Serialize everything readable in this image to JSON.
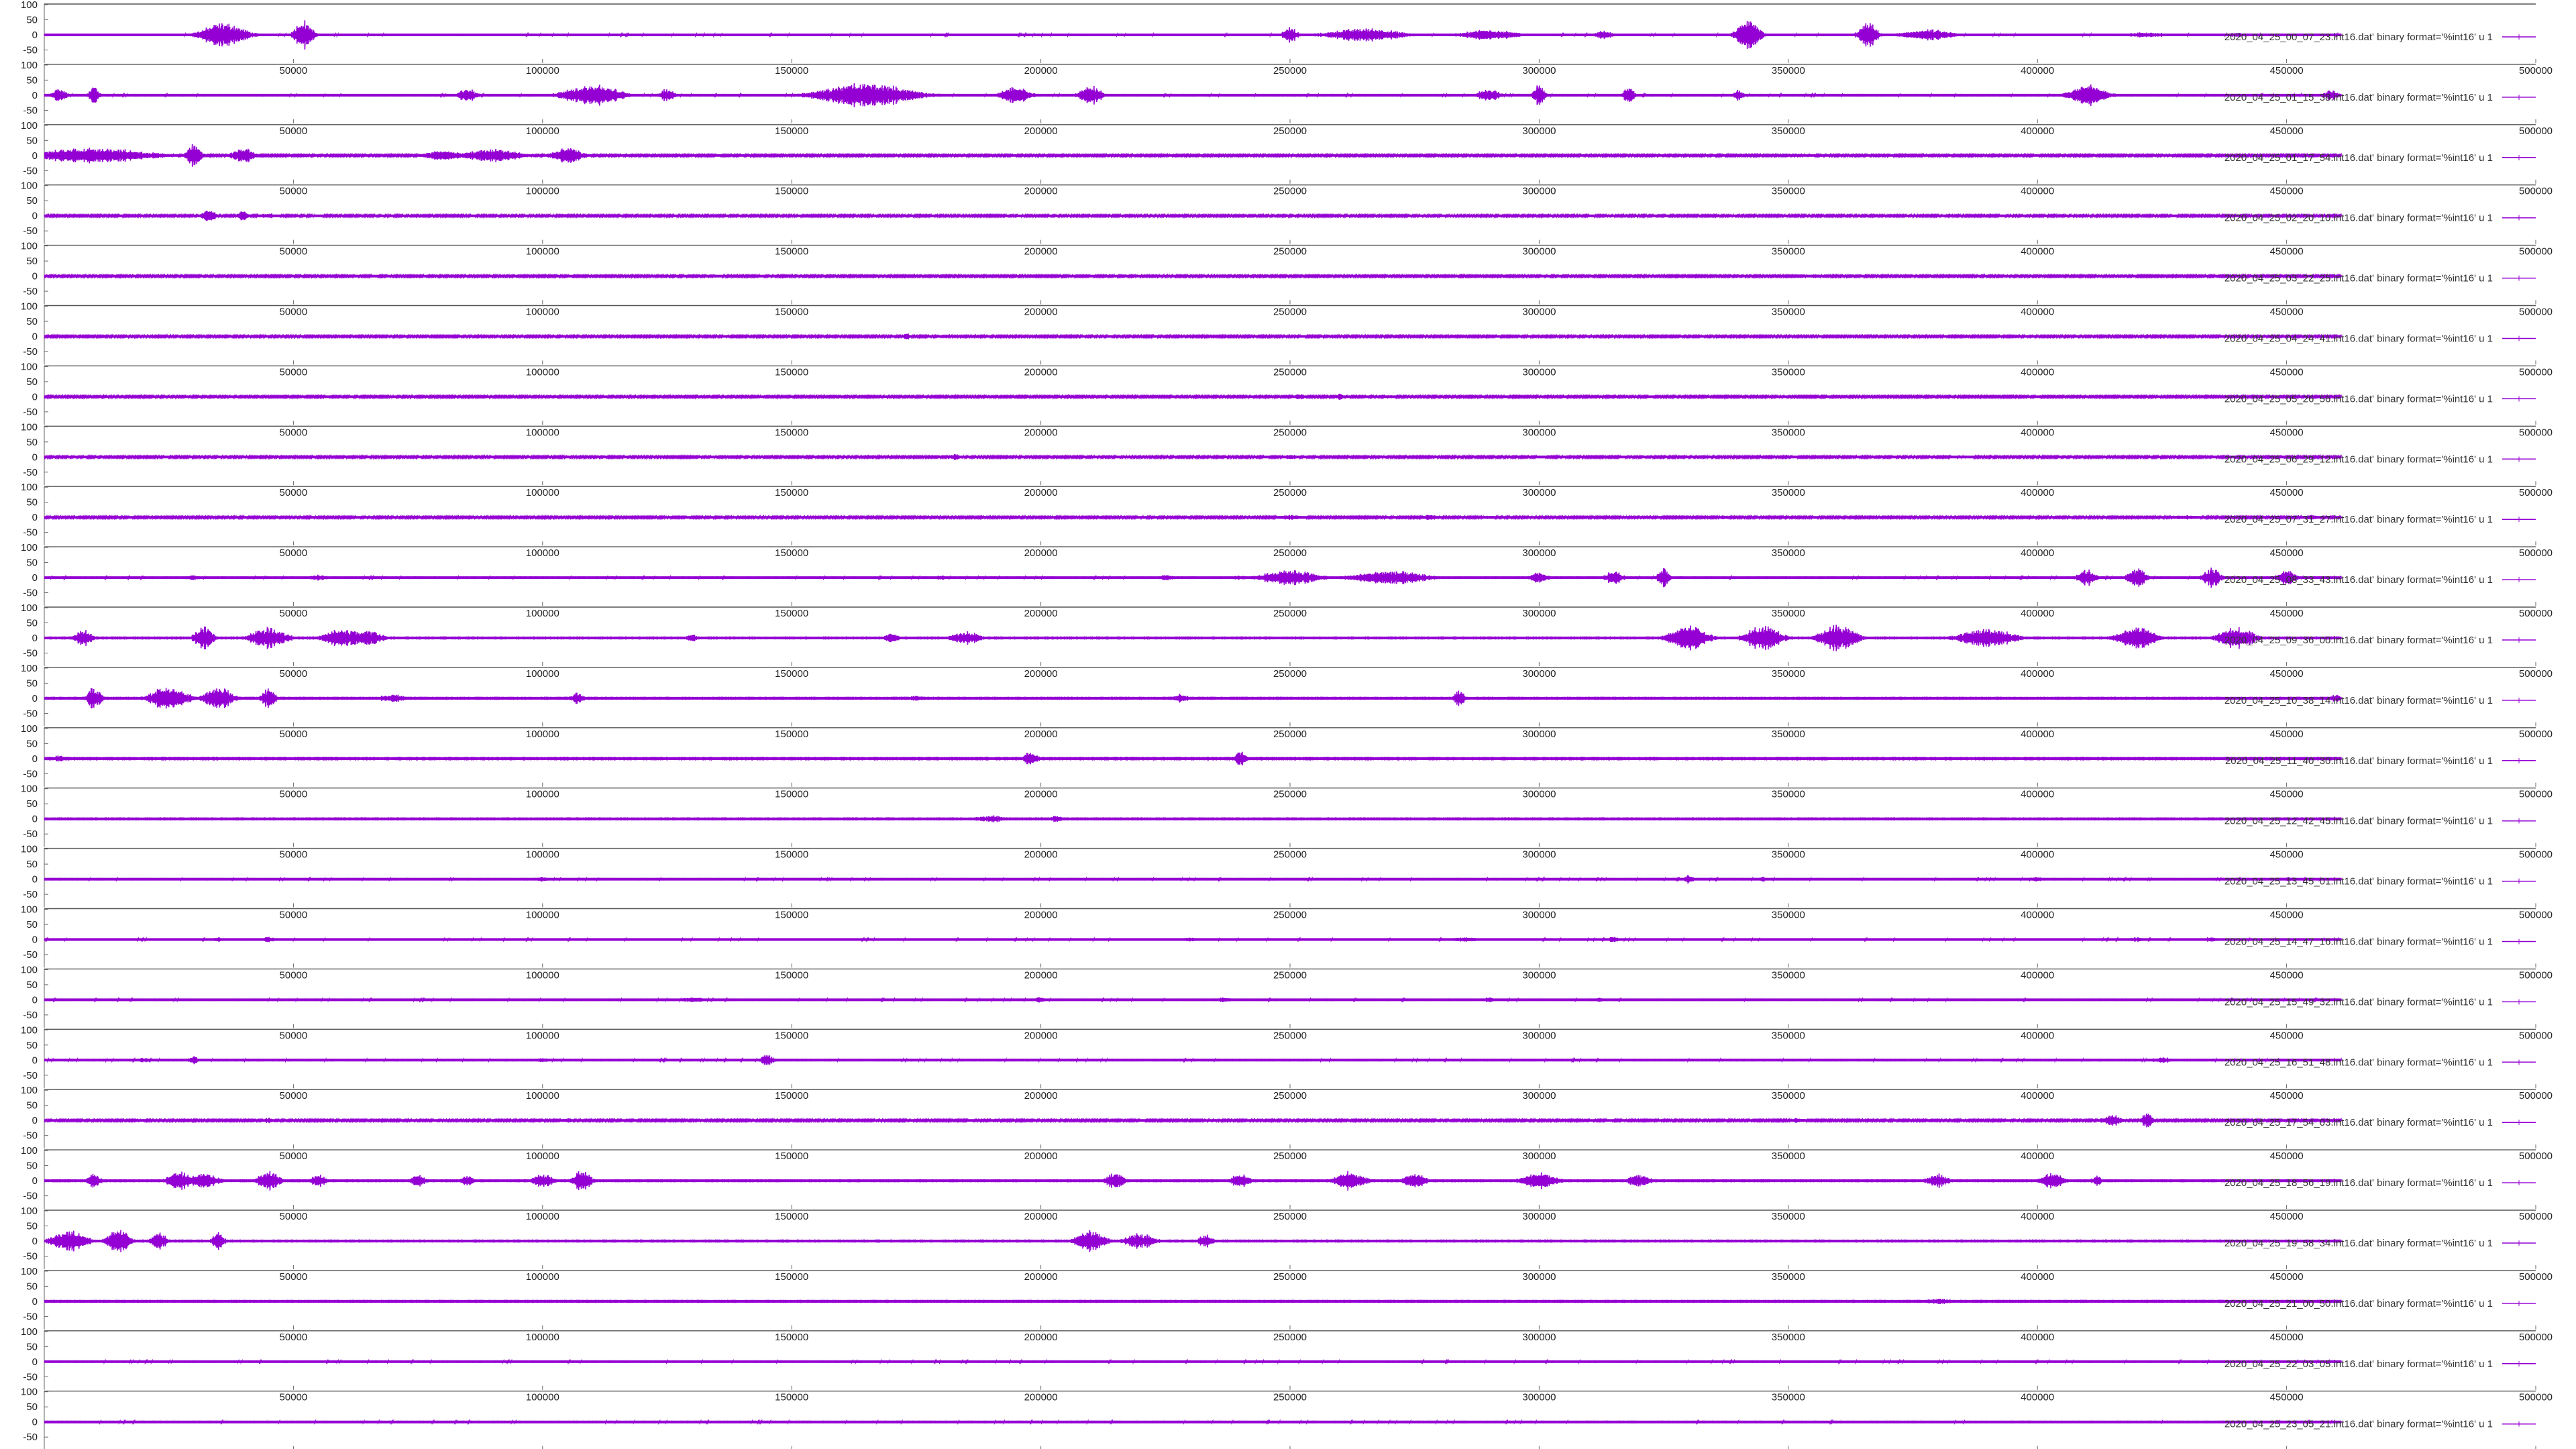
{
  "chart_data": {
    "type": "line",
    "layout": "stacked-subplots",
    "title": "",
    "xlabel": "",
    "ylabel": "",
    "xlim": [
      0,
      500000
    ],
    "ylim": [
      -100,
      100
    ],
    "xticks": [
      50000,
      100000,
      150000,
      200000,
      250000,
      300000,
      350000,
      400000,
      450000,
      500000
    ],
    "yticks": [
      100,
      50,
      0,
      -50
    ],
    "data_end_x": 461000,
    "grid": false,
    "legend_position": "right",
    "series_color": "#9400d3",
    "series_style": "lines+points",
    "series": [
      {
        "name": "2020_04_25_00_07_23.int16.dat' binary format='%int16' u 1",
        "noise": 4,
        "bursts": [
          [
            36000,
            12000,
            45
          ],
          [
            52000,
            5000,
            55
          ],
          [
            250000,
            4000,
            30
          ],
          [
            265000,
            20000,
            25
          ],
          [
            290000,
            15000,
            20
          ],
          [
            313000,
            5000,
            15
          ],
          [
            342000,
            6000,
            60
          ],
          [
            366000,
            5000,
            45
          ],
          [
            378000,
            14000,
            20
          ],
          [
            422000,
            12000,
            10
          ],
          [
            440000,
            8000,
            8
          ]
        ]
      },
      {
        "name": "2020_04_25_01_15_38.int16.dat' binary format='%int16' u 1",
        "noise": 4,
        "bursts": [
          [
            3000,
            4000,
            25
          ],
          [
            10000,
            3000,
            30
          ],
          [
            85000,
            5000,
            25
          ],
          [
            110000,
            15000,
            40
          ],
          [
            125000,
            4000,
            25
          ],
          [
            165000,
            25000,
            45
          ],
          [
            195000,
            8000,
            30
          ],
          [
            210000,
            6000,
            35
          ],
          [
            290000,
            6000,
            25
          ],
          [
            300000,
            3000,
            40
          ],
          [
            318000,
            3000,
            30
          ],
          [
            340000,
            3000,
            20
          ],
          [
            410000,
            10000,
            40
          ],
          [
            459000,
            4000,
            20
          ]
        ]
      },
      {
        "name": "2020_04_25_01_17_54.int16.dat' binary format='%int16' u 1",
        "noise": 3,
        "bursts": [
          [
            10000,
            30000,
            30
          ],
          [
            30000,
            4000,
            45
          ],
          [
            40000,
            6000,
            30
          ],
          [
            80000,
            10000,
            20
          ],
          [
            90000,
            15000,
            25
          ],
          [
            105000,
            8000,
            30
          ],
          [
            355000,
            15000,
            5
          ]
        ]
      },
      {
        "name": "2020_04_25_02_20_10.int16.dat' binary format='%int16' u 1",
        "noise": 3,
        "bursts": [
          [
            33000,
            4000,
            25
          ],
          [
            40000,
            3000,
            20
          ],
          [
            45000,
            6000,
            10
          ],
          [
            55000,
            4000,
            5
          ]
        ]
      },
      {
        "name": "2020_04_25_03_22_25.int16.dat' binary format='%int16' u 1",
        "noise": 3,
        "bursts": [
          [
            135000,
            6000,
            5
          ],
          [
            355000,
            5000,
            8
          ]
        ]
      },
      {
        "name": "2020_04_25_04_24_41.int16.dat' binary format='%int16' u 1",
        "noise": 3,
        "bursts": [
          [
            173000,
            2000,
            15
          ],
          [
            70000,
            10000,
            4
          ]
        ]
      },
      {
        "name": "2020_04_25_05_26_56.int16.dat' binary format='%int16' u 1",
        "noise": 3,
        "bursts": [
          [
            70000,
            3000,
            5
          ],
          [
            252000,
            4000,
            10
          ],
          [
            260000,
            2000,
            15
          ],
          [
            270000,
            5000,
            6
          ],
          [
            400000,
            4000,
            6
          ]
        ]
      },
      {
        "name": "2020_04_25_06_29_12.int16.dat' binary format='%int16' u 1",
        "noise": 3,
        "bursts": [
          [
            183000,
            3000,
            12
          ],
          [
            250000,
            4000,
            10
          ],
          [
            300000,
            5000,
            5
          ],
          [
            385000,
            10000,
            5
          ]
        ]
      },
      {
        "name": "2020_04_25_07_31_27.int16.dat' binary format='%int16' u 1",
        "noise": 3,
        "bursts": [
          [
            250000,
            8000,
            10
          ],
          [
            278000,
            5000,
            10
          ],
          [
            290000,
            4000,
            8
          ],
          [
            337000,
            3000,
            8
          ],
          [
            430000,
            10000,
            8
          ],
          [
            455000,
            5000,
            10
          ]
        ]
      },
      {
        "name": "2020_04_25_08_33_43.int16.dat' binary format='%int16' u 1",
        "noise": 4,
        "bursts": [
          [
            30000,
            4000,
            10
          ],
          [
            55000,
            6000,
            10
          ],
          [
            180000,
            4000,
            8
          ],
          [
            225000,
            5000,
            10
          ],
          [
            240000,
            5000,
            8
          ],
          [
            250000,
            15000,
            30
          ],
          [
            270000,
            20000,
            25
          ],
          [
            300000,
            5000,
            20
          ],
          [
            315000,
            5000,
            25
          ],
          [
            325000,
            3000,
            40
          ],
          [
            410000,
            5000,
            30
          ],
          [
            420000,
            5000,
            40
          ],
          [
            435000,
            5000,
            35
          ],
          [
            450000,
            5000,
            30
          ]
        ]
      },
      {
        "name": "2020_04_25_09_36_00.int16.dat' binary format='%int16' u 1",
        "noise": 5,
        "bursts": [
          [
            8000,
            5000,
            30
          ],
          [
            32000,
            5000,
            45
          ],
          [
            45000,
            10000,
            40
          ],
          [
            60000,
            10000,
            35
          ],
          [
            65000,
            8000,
            30
          ],
          [
            130000,
            3000,
            15
          ],
          [
            170000,
            4000,
            20
          ],
          [
            185000,
            8000,
            25
          ],
          [
            330000,
            10000,
            50
          ],
          [
            345000,
            10000,
            45
          ],
          [
            360000,
            10000,
            50
          ],
          [
            390000,
            15000,
            35
          ],
          [
            420000,
            10000,
            45
          ],
          [
            440000,
            10000,
            40
          ]
        ]
      },
      {
        "name": "2020_04_25_10_38_14.int16.dat' binary format='%int16' u 1",
        "noise": 5,
        "bursts": [
          [
            10000,
            4000,
            40
          ],
          [
            25000,
            10000,
            45
          ],
          [
            35000,
            8000,
            40
          ],
          [
            45000,
            4000,
            35
          ],
          [
            70000,
            8000,
            15
          ],
          [
            107000,
            4000,
            20
          ],
          [
            175000,
            5000,
            10
          ],
          [
            228000,
            5000,
            15
          ],
          [
            284000,
            3000,
            30
          ],
          [
            460000,
            3000,
            15
          ]
        ]
      },
      {
        "name": "2020_04_25_11_40_30.int16.dat' binary format='%int16' u 1",
        "noise": 6,
        "bursts": [
          [
            3000,
            3000,
            15
          ],
          [
            17000,
            3000,
            10
          ],
          [
            198000,
            4000,
            25
          ],
          [
            240000,
            3000,
            35
          ],
          [
            120000,
            10000,
            6
          ]
        ]
      },
      {
        "name": "2020_04_25_12_42_45.int16.dat' binary format='%int16' u 1",
        "noise": 5,
        "bursts": [
          [
            60000,
            10000,
            6
          ],
          [
            190000,
            10000,
            12
          ],
          [
            203000,
            3000,
            15
          ]
        ]
      },
      {
        "name": "2020_04_25_13_45_01.int16.dat' binary format='%int16' u 1",
        "noise": 4,
        "bursts": [
          [
            100000,
            3000,
            10
          ],
          [
            330000,
            3000,
            15
          ],
          [
            345000,
            3000,
            10
          ],
          [
            400000,
            4000,
            8
          ],
          [
            450000,
            8000,
            8
          ]
        ]
      },
      {
        "name": "2020_04_25_14_47_16.int16.dat' binary format='%int16' u 1",
        "noise": 4,
        "bursts": [
          [
            35000,
            3000,
            8
          ],
          [
            45000,
            4000,
            10
          ],
          [
            230000,
            6000,
            8
          ],
          [
            285000,
            8000,
            10
          ],
          [
            315000,
            3000,
            12
          ],
          [
            420000,
            6000,
            8
          ],
          [
            435000,
            4000,
            10
          ]
        ]
      },
      {
        "name": "2020_04_25_15_49_32.int16.dat' binary format='%int16' u 1",
        "noise": 4,
        "bursts": [
          [
            130000,
            8000,
            10
          ],
          [
            200000,
            3000,
            12
          ],
          [
            237000,
            4000,
            10
          ],
          [
            290000,
            3000,
            10
          ],
          [
            312000,
            3000,
            8
          ]
        ]
      },
      {
        "name": "2020_04_25_16_51_48.int16.dat' binary format='%int16' u 1",
        "noise": 4,
        "bursts": [
          [
            20000,
            3000,
            10
          ],
          [
            30000,
            3000,
            15
          ],
          [
            145000,
            4000,
            20
          ],
          [
            100000,
            5000,
            8
          ],
          [
            425000,
            5000,
            12
          ]
        ]
      },
      {
        "name": "2020_04_25_17_54_03.int16.dat' binary format='%int16' u 1",
        "noise": 3,
        "bursts": [
          [
            20000,
            4000,
            5
          ],
          [
            45000,
            3000,
            10
          ],
          [
            105000,
            4000,
            8
          ],
          [
            235000,
            5000,
            5
          ],
          [
            352000,
            4000,
            10
          ],
          [
            415000,
            6000,
            20
          ],
          [
            422000,
            3000,
            30
          ]
        ]
      },
      {
        "name": "2020_04_25_18_56_19.int16.dat' binary format='%int16' u 1",
        "noise": 5,
        "bursts": [
          [
            10000,
            4000,
            25
          ],
          [
            27000,
            6000,
            40
          ],
          [
            32000,
            8000,
            30
          ],
          [
            45000,
            6000,
            40
          ],
          [
            55000,
            4000,
            25
          ],
          [
            75000,
            4000,
            25
          ],
          [
            85000,
            4000,
            20
          ],
          [
            100000,
            6000,
            25
          ],
          [
            108000,
            5000,
            40
          ],
          [
            215000,
            5000,
            30
          ],
          [
            240000,
            5000,
            30
          ],
          [
            262000,
            8000,
            35
          ],
          [
            275000,
            6000,
            30
          ],
          [
            300000,
            10000,
            30
          ],
          [
            320000,
            6000,
            25
          ],
          [
            380000,
            6000,
            25
          ],
          [
            403000,
            6000,
            30
          ],
          [
            412000,
            3000,
            20
          ]
        ]
      },
      {
        "name": "2020_04_25_19_58_34.int16.dat' binary format='%int16' u 1",
        "noise": 5,
        "bursts": [
          [
            5000,
            10000,
            40
          ],
          [
            15000,
            6000,
            45
          ],
          [
            23000,
            4000,
            35
          ],
          [
            35000,
            3000,
            40
          ],
          [
            210000,
            8000,
            40
          ],
          [
            220000,
            8000,
            30
          ],
          [
            233000,
            4000,
            25
          ],
          [
            245000,
            6000,
            5
          ]
        ]
      },
      {
        "name": "2020_04_25_21_00_50.int16.dat' binary format='%int16' u 1",
        "noise": 5,
        "bursts": [
          [
            115000,
            8000,
            5
          ],
          [
            380000,
            10000,
            10
          ],
          [
            235000,
            30000,
            4
          ]
        ]
      },
      {
        "name": "2020_04_25_22_03_05.int16.dat' binary format='%int16' u 1",
        "noise": 4,
        "bursts": [
          [
            285000,
            3000,
            6
          ],
          [
            200000,
            30000,
            3
          ]
        ]
      },
      {
        "name": "2020_04_25_23_05_21.int16.dat' binary format='%int16' u 1",
        "noise": 4,
        "bursts": [
          [
            398000,
            8000,
            5
          ],
          [
            50000,
            6000,
            3
          ]
        ]
      }
    ]
  }
}
